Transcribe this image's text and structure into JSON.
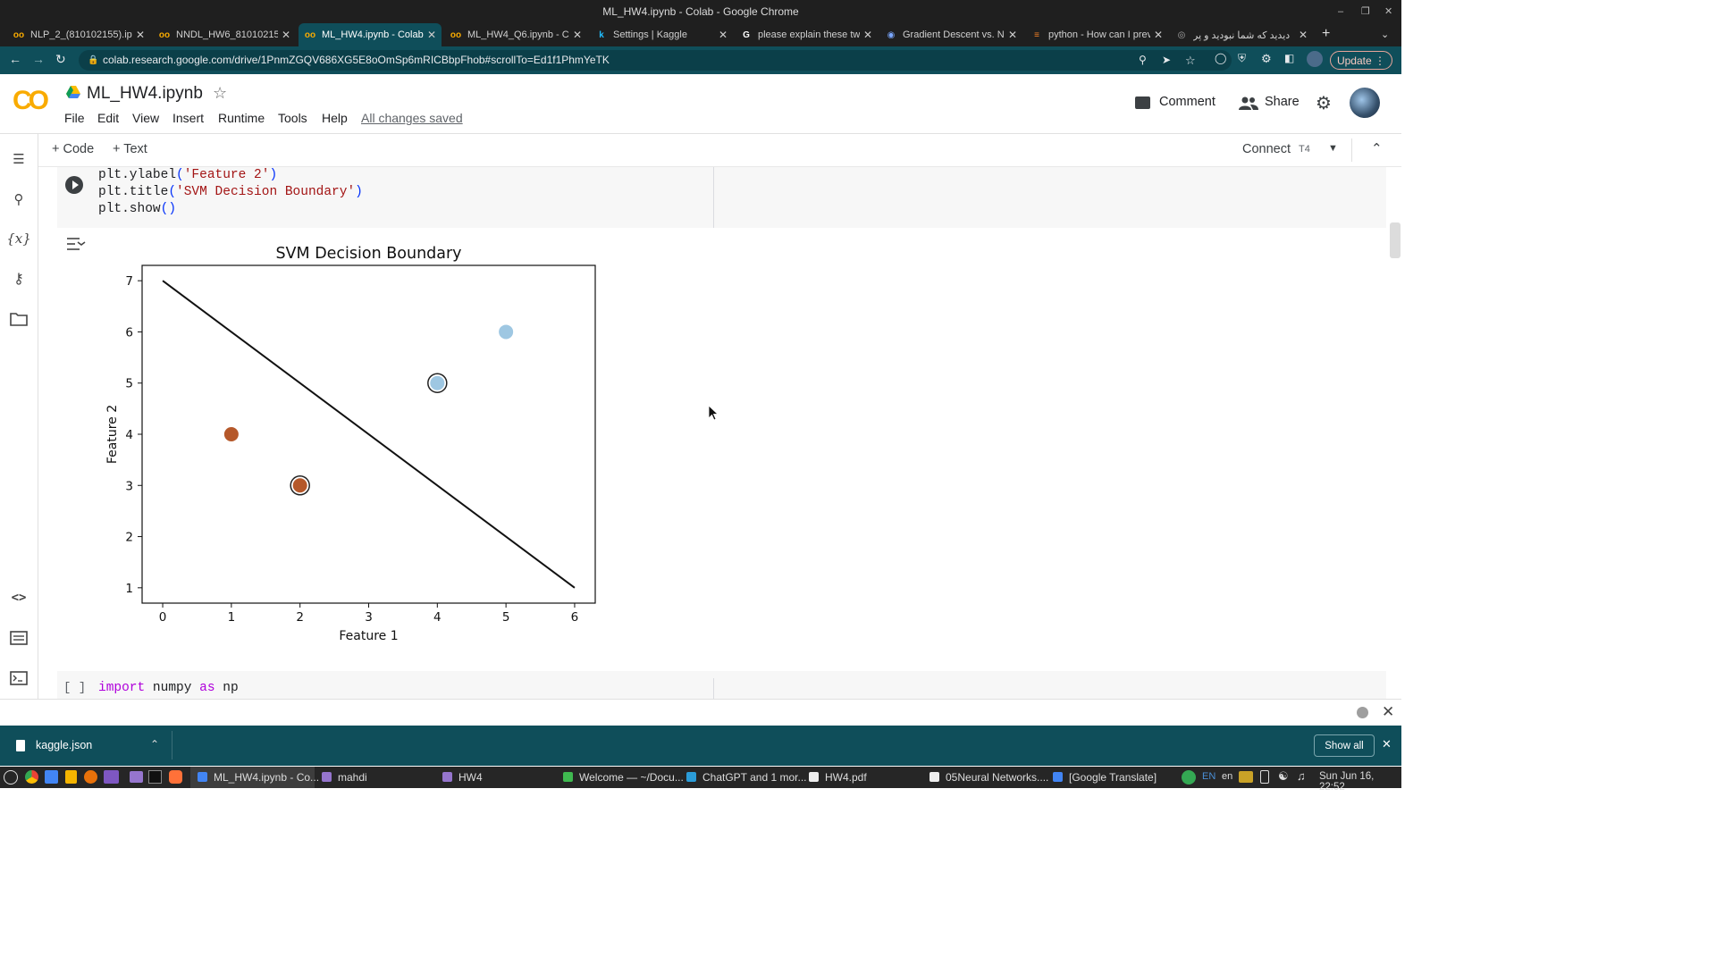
{
  "window": {
    "title": "ML_HW4.ipynb - Colab - Google Chrome"
  },
  "browser": {
    "tabs": [
      {
        "label": "NLP_2_(810102155).ipy",
        "icon": "colab-icon",
        "active": false
      },
      {
        "label": "NNDL_HW6_81010215",
        "icon": "colab-icon",
        "active": false
      },
      {
        "label": "ML_HW4.ipynb - Colab",
        "icon": "colab-icon",
        "active": true
      },
      {
        "label": "ML_HW4_Q6.ipynb - Co",
        "icon": "colab-icon",
        "active": false
      },
      {
        "label": "Settings | Kaggle",
        "icon": "kaggle-icon",
        "active": false
      },
      {
        "label": "please explain these tw",
        "icon": "google-icon",
        "active": false
      },
      {
        "label": "Gradient Descent vs. N",
        "icon": "globe-icon",
        "active": false
      },
      {
        "label": "python - How can I prev",
        "icon": "stackoverflow-icon",
        "active": false
      },
      {
        "label": "دیدید که شما نبودید و پر",
        "icon": "page-icon",
        "active": false
      }
    ],
    "url": "colab.research.google.com/drive/1PnmZGQV686XG5E8oOmSp6mRICBbpFhob#scrollTo=Ed1f1PhmYeTK",
    "update_label": "Update"
  },
  "colab": {
    "logo": "CO",
    "notebook_title": "ML_HW4.ipynb",
    "menu": [
      "File",
      "Edit",
      "View",
      "Insert",
      "Runtime",
      "Tools",
      "Help"
    ],
    "save_status": "All changes saved",
    "comment_label": "Comment",
    "share_label": "Share",
    "add_code_label": "+ Code",
    "add_text_label": "+ Text",
    "connect_label": "Connect",
    "runtime_type": "T4"
  },
  "cell_source": {
    "lines": [
      {
        "fn": "plt.ylabel",
        "open": "(",
        "arg": "'Feature 2'",
        "close": ")"
      },
      {
        "fn": "plt.title",
        "open": "(",
        "arg": "'SVM Decision Boundary'",
        "close": ")"
      },
      {
        "fn": "plt.show",
        "open": "(",
        "arg": "",
        "close": ")"
      }
    ]
  },
  "next_cell": {
    "bracket": "[ ]",
    "kw_import": "import",
    "module": "numpy",
    "kw_as": "as",
    "alias": "np"
  },
  "chart_data": {
    "type": "scatter",
    "title": "SVM Decision Boundary",
    "xlabel": "Feature 1",
    "ylabel": "Feature 2",
    "xlim": [
      -0.3,
      6.3
    ],
    "ylim": [
      0.7,
      7.3
    ],
    "xticks": [
      0,
      1,
      2,
      3,
      4,
      5,
      6
    ],
    "yticks": [
      1,
      2,
      3,
      4,
      5,
      6,
      7
    ],
    "grid": false,
    "points": [
      {
        "x": 1,
        "y": 4,
        "color": "#b5582a",
        "support_vector": false
      },
      {
        "x": 2,
        "y": 3,
        "color": "#b5582a",
        "support_vector": true
      },
      {
        "x": 4,
        "y": 5,
        "color": "#9ec7e2",
        "support_vector": true
      },
      {
        "x": 5,
        "y": 6,
        "color": "#9ec7e2",
        "support_vector": false
      }
    ],
    "boundary": {
      "x": [
        0,
        6
      ],
      "y": [
        7,
        1
      ],
      "color": "#111111"
    }
  },
  "downloads": {
    "file": "kaggle.json",
    "show_all_label": "Show all"
  },
  "taskbar": {
    "items": [
      "ML_HW4.ipynb - Co...",
      "mahdi",
      "HW4",
      "Welcome — ~/Docu...",
      "ChatGPT and 1 mor...",
      "HW4.pdf",
      "05Neural Networks....",
      "[Google Translate]"
    ],
    "lang": "EN",
    "lang2": "en",
    "clock": "Sun Jun 16, 22:52"
  }
}
